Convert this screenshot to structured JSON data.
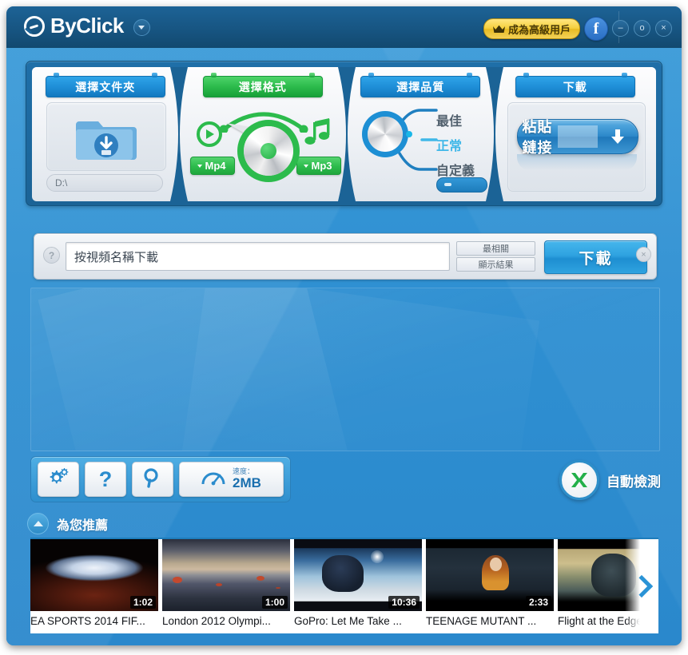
{
  "titlebar": {
    "brand": "ByClick",
    "premium_label": "成為高級用戶",
    "facebook_label": "f",
    "minimize": "–",
    "maximize": "o",
    "close": "×"
  },
  "steps": [
    {
      "tab": "選擇文件夾",
      "path_value": "D:\\"
    },
    {
      "tab": "選擇格式",
      "video_format": "Mp4",
      "audio_format": "Mp3"
    },
    {
      "tab": "選擇品質",
      "options": [
        "最佳",
        "正常",
        "自定義"
      ],
      "selected": "正常"
    },
    {
      "tab": "下載",
      "paste_label": "粘貼鏈接"
    }
  ],
  "search": {
    "help_label": "?",
    "input_value": "按視頻名稱下載",
    "placeholder": "按視頻名稱下載",
    "filter_label": "最相關",
    "show_results_label": "顯示結果",
    "download_label": "下載",
    "close_label": "×"
  },
  "toolbar": {
    "settings_name": "gear-icon",
    "help_label": "?",
    "search_name": "magnifier-icon",
    "speed_name": "gauge-icon",
    "speed_label": "速度：",
    "speed_value": "2MB",
    "autodetect_label": "自動檢測"
  },
  "recommendations": {
    "title": "為您推薦",
    "next_label": "›",
    "items": [
      {
        "title": "EA SPORTS 2014 FIF...",
        "duration": "1:02",
        "art": "art-stadium"
      },
      {
        "title": "London 2012 Olympi...",
        "duration": "1:00",
        "art": "art-lake"
      },
      {
        "title": "GoPro: Let Me Take ...",
        "duration": "10:36",
        "art": "art-gopro"
      },
      {
        "title": "TEENAGE MUTANT ...",
        "duration": "2:33",
        "art": "art-tmnt"
      },
      {
        "title": "Flight at the Edge o",
        "duration": "",
        "art": "art-flight"
      }
    ]
  },
  "colors": {
    "accent_blue": "#2e8fce",
    "title_blue": "#17567f",
    "green": "#2cbb4c",
    "premium_yellow": "#f5cf3d",
    "cyan_selected": "#3fb7e8"
  }
}
